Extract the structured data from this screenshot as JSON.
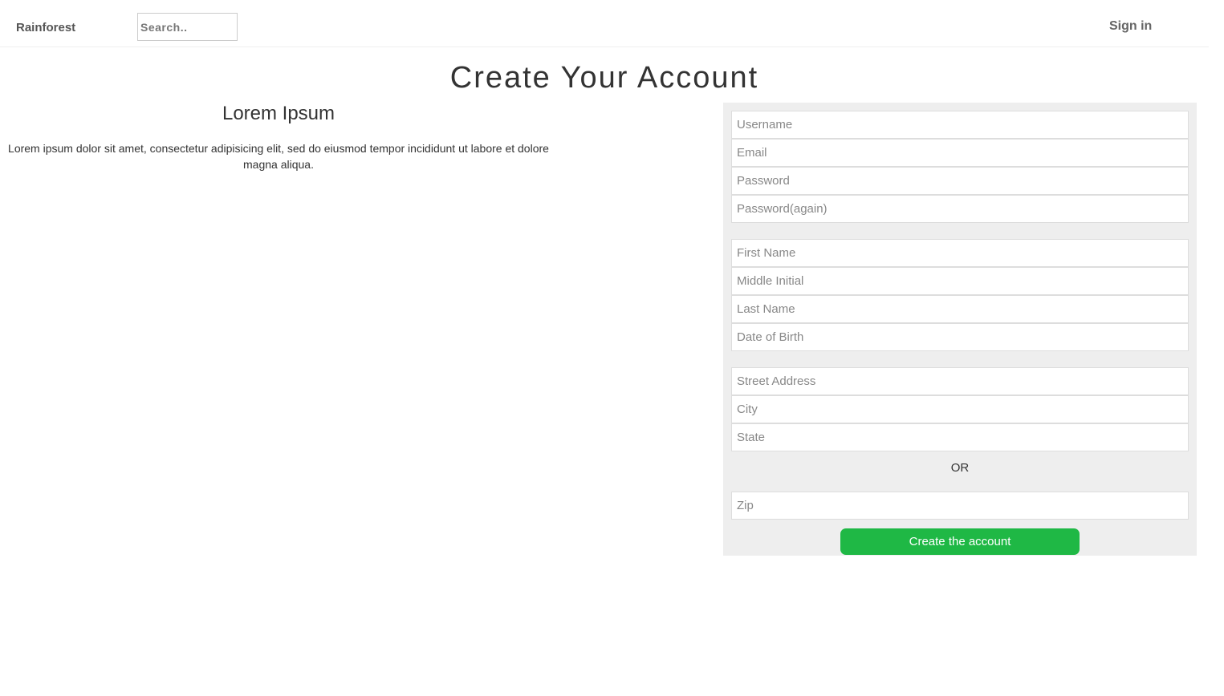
{
  "navbar": {
    "brand": "Rainforest",
    "search_placeholder": "Search..",
    "signin_label": "Sign in"
  },
  "page": {
    "title": "Create Your Account"
  },
  "intro": {
    "heading": "Lorem Ipsum",
    "text": "Lorem ipsum dolor sit amet, consectetur adipisicing elit, sed do eiusmod tempor incididunt ut labore et dolore magna aliqua."
  },
  "form": {
    "account_fields": {
      "username_placeholder": "Username",
      "email_placeholder": "Email",
      "password_placeholder": "Password",
      "password_again_placeholder": "Password(again)"
    },
    "personal_fields": {
      "first_name_placeholder": "First Name",
      "middle_initial_placeholder": "Middle Initial",
      "last_name_placeholder": "Last Name",
      "dob_placeholder": "Date of Birth"
    },
    "address_fields": {
      "street_placeholder": "Street Address",
      "city_placeholder": "City",
      "state_placeholder": "State"
    },
    "or_label": "OR",
    "zip_placeholder": "Zip",
    "submit_label": "Create the account"
  },
  "colors": {
    "panel_bg": "#eeeeee",
    "button_bg": "#1fb845",
    "button_text": "#ffffff"
  }
}
